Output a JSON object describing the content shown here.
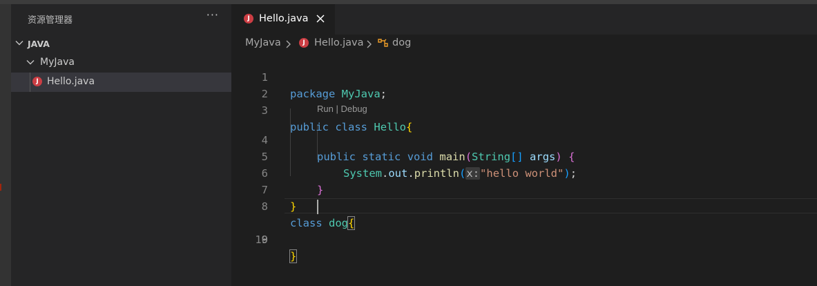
{
  "sidebar": {
    "title": "资源管理器",
    "more_label": "···",
    "tree": {
      "root_label": "JAVA",
      "folder_label": "MyJava",
      "file_label": "Hello.java"
    }
  },
  "tabs": [
    {
      "label": "Hello.java",
      "icon": "java-file-icon",
      "active": true
    }
  ],
  "breadcrumb": {
    "folder": "MyJava",
    "file": "Hello.java",
    "symbol": "dog"
  },
  "codelens": {
    "run": "Run",
    "separator": " | ",
    "debug": "Debug"
  },
  "editor": {
    "line_numbers": [
      "1",
      "2",
      "3",
      "4",
      "5",
      "6",
      "7",
      "8",
      "9",
      "10"
    ],
    "active_line": "9",
    "code": {
      "l1_kw": "package",
      "l1_name": "MyJava",
      "l1_semi": ";",
      "l3_kw1": "public",
      "l3_kw2": "class",
      "l3_name": "Hello",
      "l3_brace": "{",
      "l4_kw1": "public",
      "l4_kw2": "static",
      "l4_kw3": "void",
      "l4_fn": "main",
      "l4_paren_open": "(",
      "l4_type": "String",
      "l4_arr": "[]",
      "l4_arg": "args",
      "l4_paren_close": ")",
      "l4_brace": "{",
      "l5_obj": "System",
      "l5_dot1": ".",
      "l5_field": "out",
      "l5_dot2": ".",
      "l5_fn": "println",
      "l5_paren_open": "(",
      "l5_hint": "x:",
      "l5_str": "\"hello world\"",
      "l5_paren_close": ")",
      "l5_semi": ";",
      "l6_brace": "}",
      "l7_brace": "}",
      "l8_kw": "class",
      "l8_name": "dog",
      "l8_brace": "{",
      "l10_brace": "}"
    }
  },
  "colors": {
    "java_icon": "#cc3e44",
    "keyword": "#569cd6",
    "type": "#4ec9b0",
    "function": "#dcdcaa",
    "string": "#ce9178"
  }
}
